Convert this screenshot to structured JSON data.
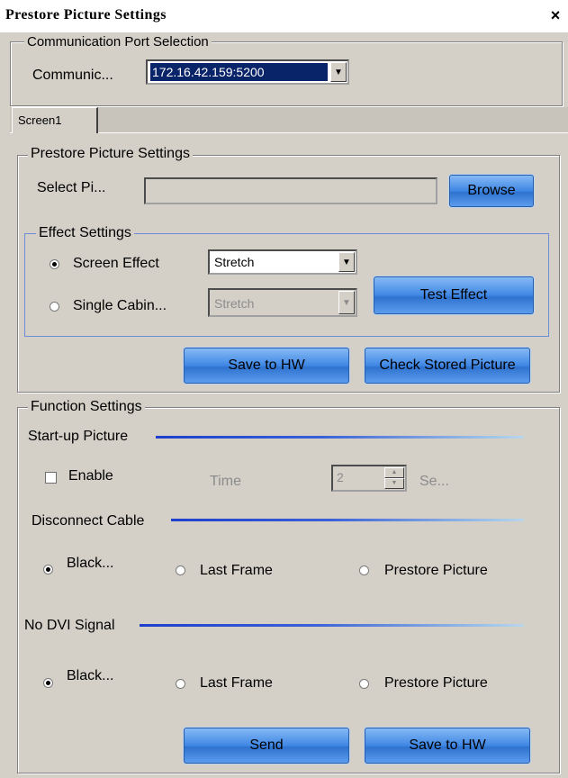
{
  "window": {
    "title": "Prestore Picture Settings",
    "close": "×"
  },
  "comm": {
    "group_label": "Communication Port Selection",
    "port_label": "Communic...",
    "port_value": "172.16.42.159:5200"
  },
  "tabs": [
    {
      "label": "Screen1"
    }
  ],
  "prestore": {
    "group_label": "Prestore Picture Settings",
    "select_label": "Select Pi...",
    "path_value": "",
    "browse_label": "Browse",
    "effect": {
      "group_label": "Effect Settings",
      "screen_effect_label": "Screen Effect",
      "screen_effect_value": "Stretch",
      "screen_effect_selected": true,
      "single_cabinet_label": "Single Cabin...",
      "single_cabinet_value": "Stretch",
      "single_cabinet_selected": false,
      "test_label": "Test Effect"
    },
    "save_hw_label": "Save to HW",
    "check_label": "Check Stored Picture"
  },
  "function": {
    "group_label": "Function Settings",
    "startup": {
      "label": "Start-up Picture",
      "enable_label": "Enable",
      "enable_checked": false,
      "time_label": "Time",
      "time_value": "2",
      "unit_label": "Se..."
    },
    "disconnect": {
      "label": "Disconnect Cable",
      "options": [
        "Black...",
        "Last Frame",
        "Prestore Picture"
      ],
      "selected": 0
    },
    "no_dvi": {
      "label": "No DVI Signal",
      "options": [
        "Black...",
        "Last Frame",
        "Prestore Picture"
      ],
      "selected": 0
    },
    "send_label": "Send",
    "save_hw_label": "Save to HW"
  }
}
